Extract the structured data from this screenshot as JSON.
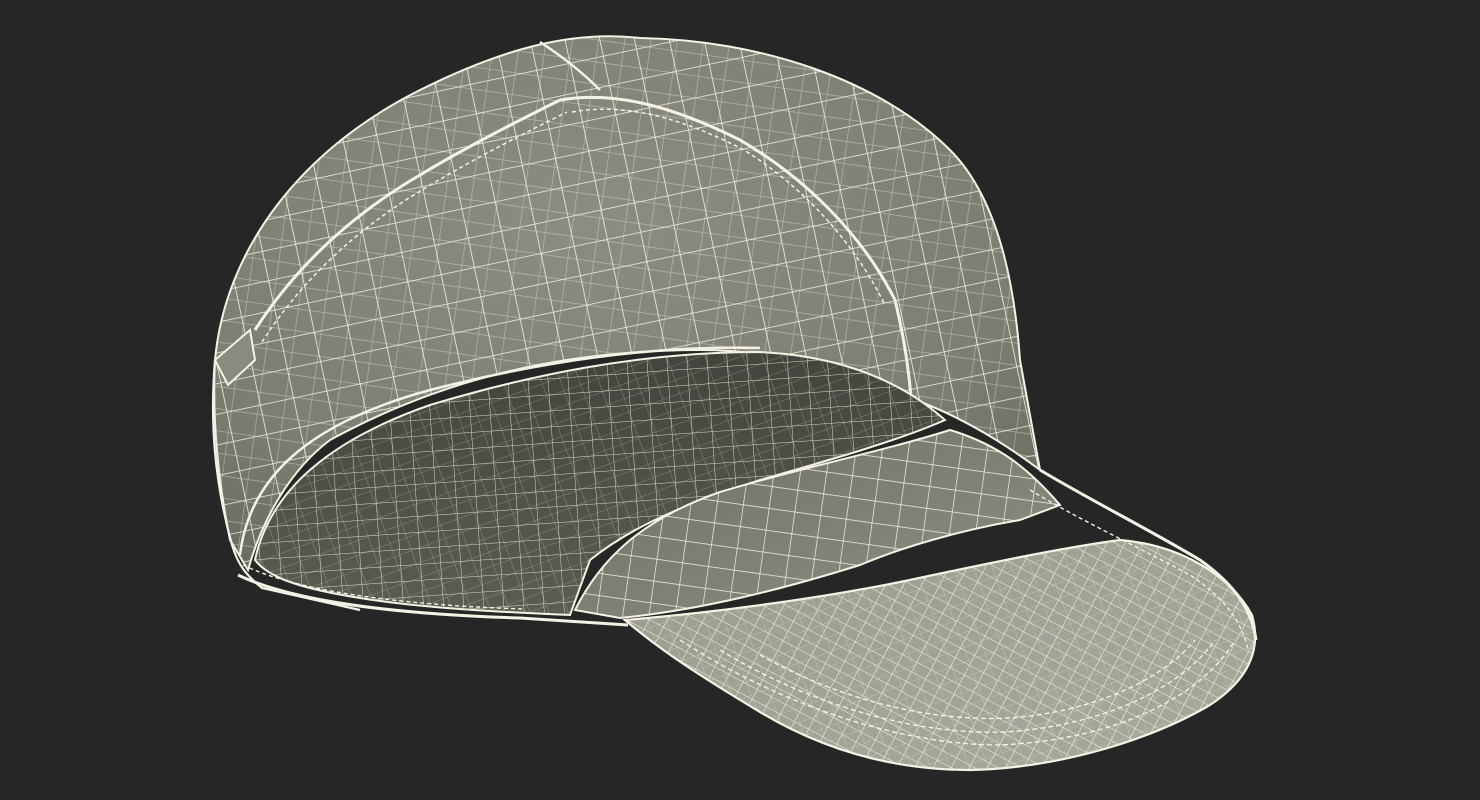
{
  "scene": {
    "subject": "cap-wireframe-render",
    "colors": {
      "background": "#262626",
      "outer_shell": "#85857a",
      "outer_shell_light": "#9a9a8d",
      "inner_shell": "#5b5b52",
      "inner_shell_dark": "#4a4a43",
      "visor_top": "#74746a",
      "visor_bottom": "#a4a497",
      "wire": "#f4f2e4"
    }
  }
}
